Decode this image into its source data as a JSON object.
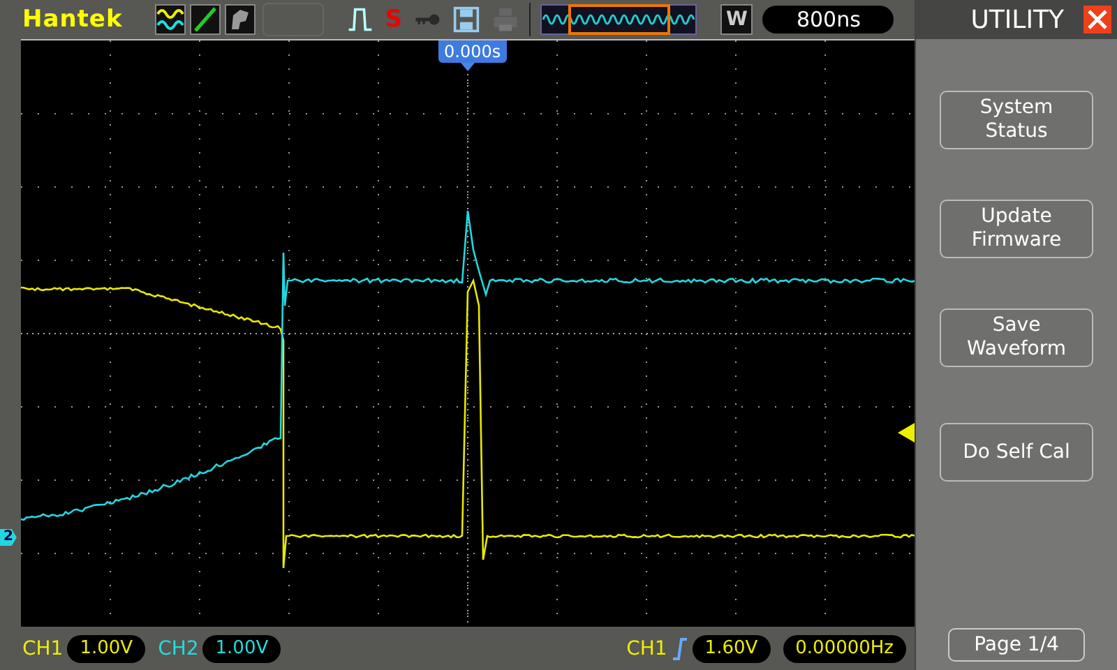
{
  "top_bar": {
    "brand": "Hantek",
    "status_letter": "S",
    "timebase_mode": "W",
    "timebase": "800ns"
  },
  "screen": {
    "trigger_position": "0.000s",
    "ch2_marker": "2"
  },
  "bottom_bar": {
    "ch1_label": "CH1",
    "ch1_scale": "1.00V",
    "ch2_label": "CH2",
    "ch2_scale": "1.00V",
    "trigger_source": "CH1",
    "trigger_level": "1.60V",
    "frequency": "0.00000Hz"
  },
  "menu": {
    "title": "UTILITY",
    "buttons": [
      {
        "lines": [
          "System",
          "Status"
        ]
      },
      {
        "lines": [
          "Update",
          "Firmware"
        ]
      },
      {
        "lines": [
          "Save",
          "Waveform"
        ]
      },
      {
        "lines": [
          "Do Self Cal"
        ]
      }
    ],
    "page": "Page 1/4"
  }
}
